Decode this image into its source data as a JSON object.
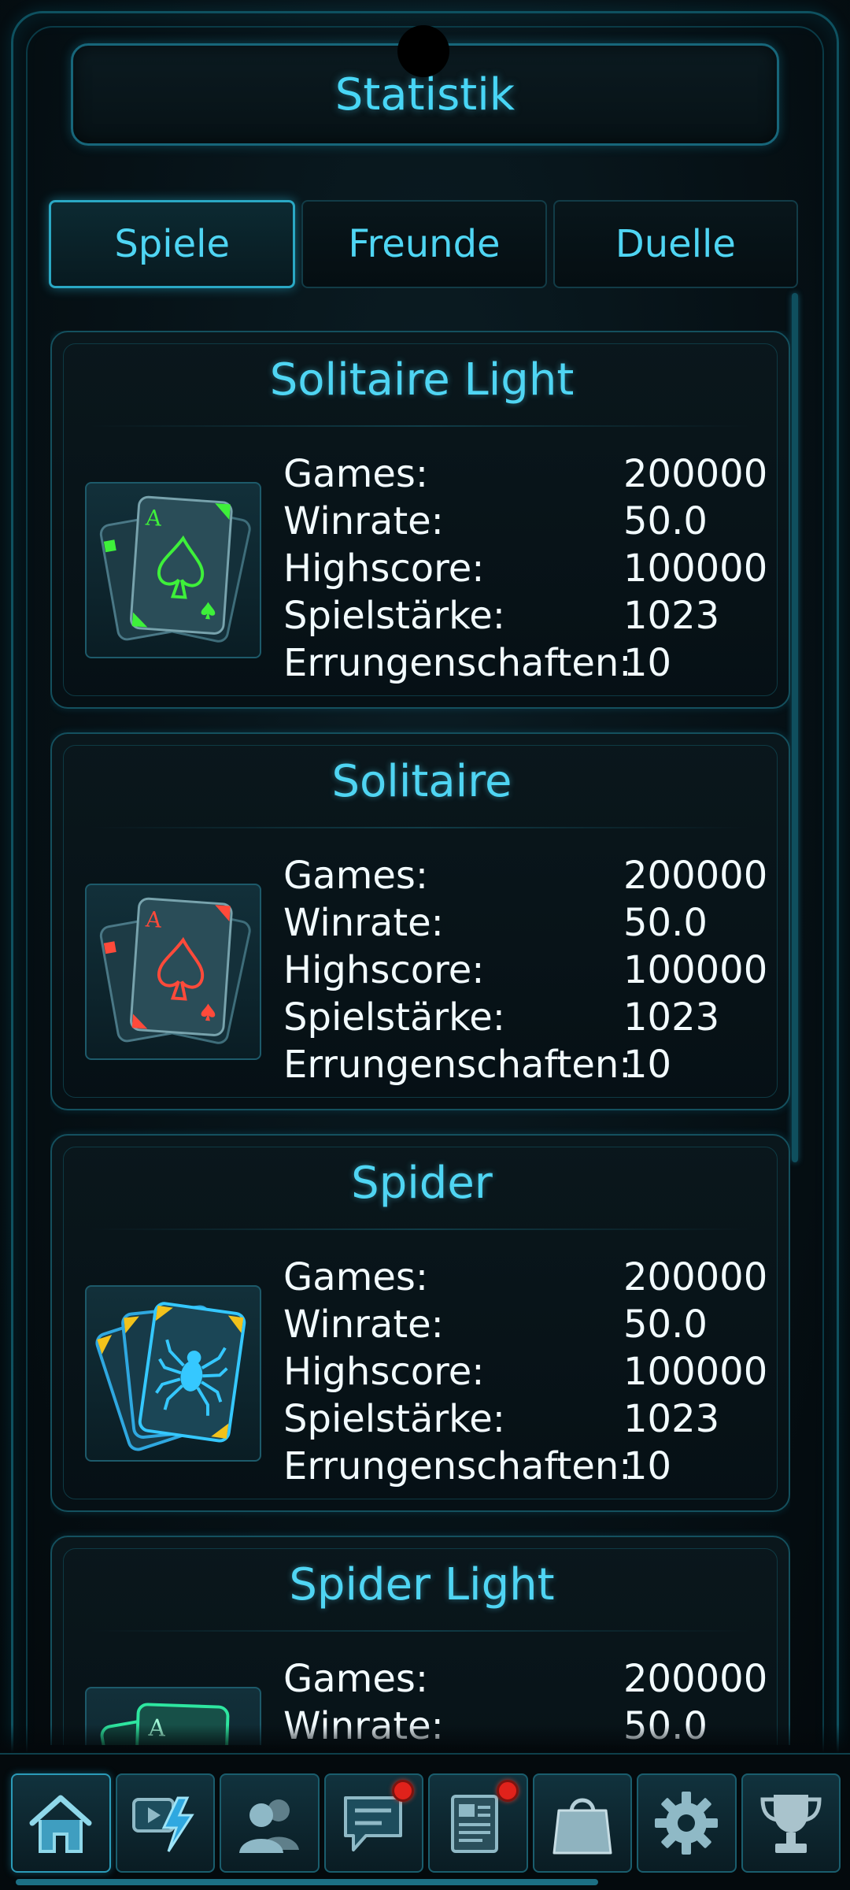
{
  "header": {
    "title": "Statistik"
  },
  "tabs": [
    {
      "label": "Spiele",
      "active": true
    },
    {
      "label": "Freunde",
      "active": false
    },
    {
      "label": "Duelle",
      "active": false
    }
  ],
  "stat_labels": {
    "games": "Games:",
    "winrate": "Winrate:",
    "highscore": "Highscore:",
    "strength": "Spielstärke:",
    "achievements": "Errungenschaften:"
  },
  "games": [
    {
      "title": "Solitaire Light",
      "icon": "ace-of-spades-green-icon",
      "accent": "#3ef03a",
      "stats": {
        "games": "200000",
        "winrate": "50.0",
        "highscore": "100000",
        "strength": "1023",
        "achievements": "10"
      }
    },
    {
      "title": "Solitaire",
      "icon": "ace-of-spades-red-icon",
      "accent": "#ff4a3a",
      "stats": {
        "games": "200000",
        "winrate": "50.0",
        "highscore": "100000",
        "strength": "1023",
        "achievements": "10"
      }
    },
    {
      "title": "Spider",
      "icon": "spider-cards-icon",
      "accent": "#35c8ff",
      "stats": {
        "games": "200000",
        "winrate": "50.0",
        "highscore": "100000",
        "strength": "1023",
        "achievements": "10"
      }
    },
    {
      "title": "Spider Light",
      "icon": "spider-light-cards-icon",
      "accent": "#2ee6a0",
      "stats": {
        "games": "200000",
        "winrate": "50.0"
      }
    }
  ],
  "card_letter": "A",
  "bottom_nav": [
    {
      "icon": "home-icon",
      "active": true
    },
    {
      "icon": "video-flash-icon",
      "active": false
    },
    {
      "icon": "friends-icon",
      "active": false
    },
    {
      "icon": "chat-icon",
      "active": false,
      "badge": true
    },
    {
      "icon": "news-icon",
      "active": false,
      "badge": true
    },
    {
      "icon": "shop-bag-icon",
      "active": false
    },
    {
      "icon": "settings-gear-icon",
      "active": false
    },
    {
      "icon": "trophy-icon",
      "active": false
    }
  ],
  "colors": {
    "accent": "#4fd5f3",
    "border": "#14505e",
    "badge": "#e0221b"
  }
}
